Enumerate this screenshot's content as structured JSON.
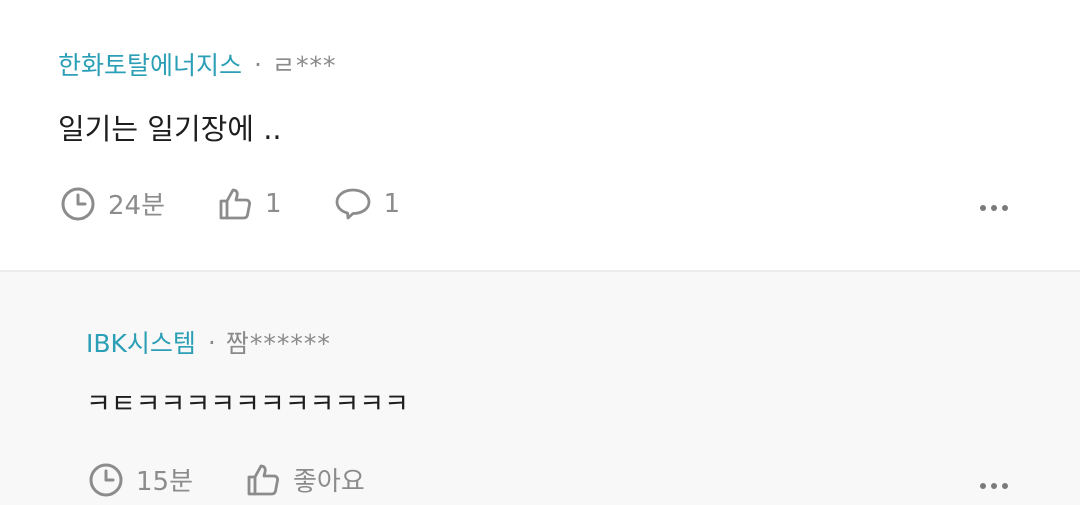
{
  "comments": [
    {
      "company": "한화토탈에너지스",
      "separator": "·",
      "user": "ㄹ***",
      "body": "일기는 일기장에 ..",
      "time": "24분",
      "likes": "1",
      "replies": "1"
    },
    {
      "company": "IBK시스템",
      "separator": "·",
      "user": "짬******",
      "body": "ㅋㅌㅋㅋㅋㅋㅋㅋㅋㅋㅋㅋㅋ",
      "time": "15분",
      "like_label": "좋아요"
    }
  ]
}
